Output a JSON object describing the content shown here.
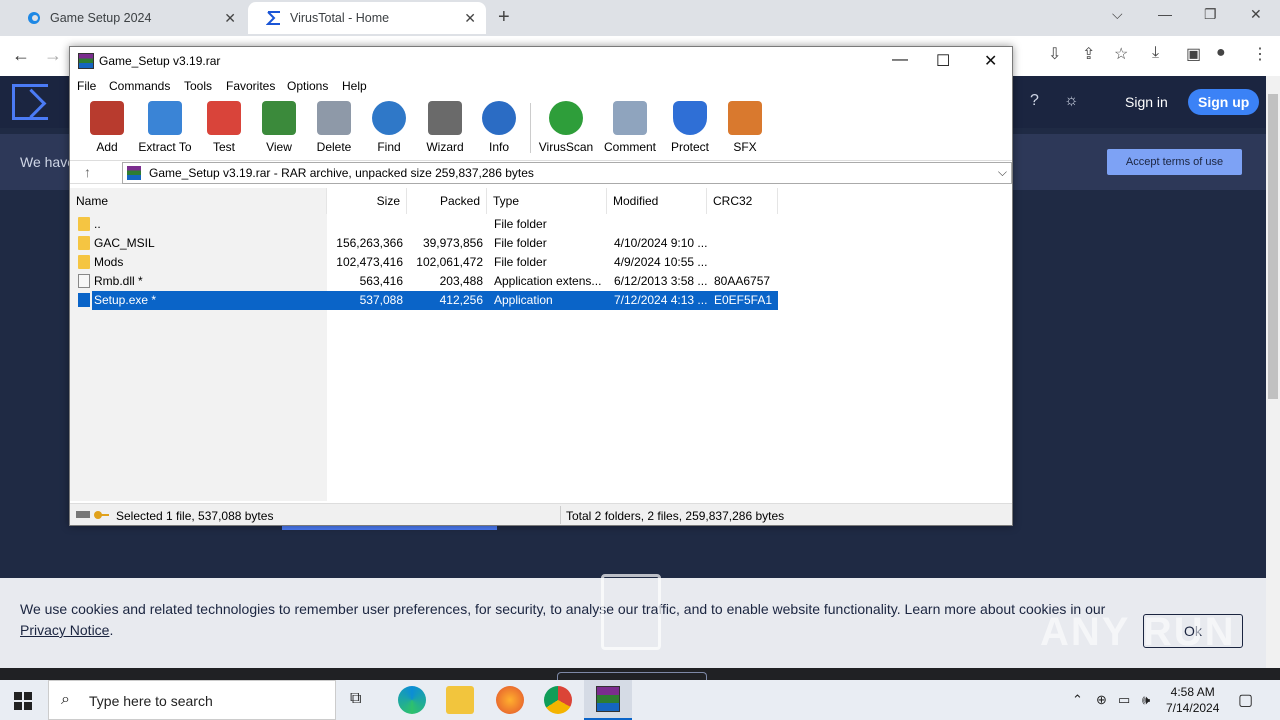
{
  "browser": {
    "tabs": [
      {
        "title": "Game Setup 2024"
      },
      {
        "title": "VirusTotal - Home"
      }
    ]
  },
  "virustotal": {
    "signin": "Sign in",
    "signup": "Sign up",
    "banner_text": "We have",
    "accept_terms": "Accept terms of use",
    "cookie_text": "We use cookies and related technologies to remember user preferences, for security, to analyse our traffic, and to enable website functionality. Learn more about cookies in our ",
    "cookie_link": "Privacy Notice",
    "cookie_ok": "Ok",
    "watermark": "ANY RUN"
  },
  "winrar": {
    "title": "Game_Setup v3.19.rar",
    "menu": [
      "File",
      "Commands",
      "Tools",
      "Favorites",
      "Options",
      "Help"
    ],
    "toolbar": [
      {
        "label": "Add",
        "icon": "add-archive-icon",
        "color": "#b83b2e"
      },
      {
        "label": "Extract To",
        "icon": "extract-folder-icon",
        "color": "#3a84d6"
      },
      {
        "label": "Test",
        "icon": "test-checklist-icon",
        "color": "#d9443a"
      },
      {
        "label": "View",
        "icon": "view-book-icon",
        "color": "#3b8a3b"
      },
      {
        "label": "Delete",
        "icon": "delete-trash-icon",
        "color": "#8e99a8"
      },
      {
        "label": "Find",
        "icon": "find-magnifier-icon",
        "color": "#2f78c8"
      },
      {
        "label": "Wizard",
        "icon": "wizard-wand-icon",
        "color": "#6a6a6a"
      },
      {
        "label": "Info",
        "icon": "info-icon",
        "color": "#2b6cc4"
      },
      {
        "label": "VirusScan",
        "icon": "virusscan-bug-icon",
        "color": "#2e9e3a"
      },
      {
        "label": "Comment",
        "icon": "comment-icon",
        "color": "#8fa4be"
      },
      {
        "label": "Protect",
        "icon": "protect-shield-icon",
        "color": "#2f6fd6"
      },
      {
        "label": "SFX",
        "icon": "sfx-box-icon",
        "color": "#d9792e"
      }
    ],
    "address": "Game_Setup v3.19.rar - RAR archive, unpacked size 259,837,286 bytes",
    "columns": [
      "Name",
      "Size",
      "Packed",
      "Type",
      "Modified",
      "CRC32"
    ],
    "rows": [
      {
        "name": "..",
        "size": "",
        "packed": "",
        "type": "File folder",
        "modified": "",
        "crc": "",
        "kind": "folder"
      },
      {
        "name": "GAC_MSIL",
        "size": "156,263,366",
        "packed": "39,973,856",
        "type": "File folder",
        "modified": "4/10/2024 9:10 ...",
        "crc": "",
        "kind": "folder"
      },
      {
        "name": "Mods",
        "size": "102,473,416",
        "packed": "102,061,472",
        "type": "File folder",
        "modified": "4/9/2024 10:55 ...",
        "crc": "",
        "kind": "folder"
      },
      {
        "name": "Rmb.dll *",
        "size": "563,416",
        "packed": "203,488",
        "type": "Application extens...",
        "modified": "6/12/2013 3:58 ...",
        "crc": "80AA6757",
        "kind": "dll"
      },
      {
        "name": "Setup.exe *",
        "size": "537,088",
        "packed": "412,256",
        "type": "Application",
        "modified": "7/12/2024 4:13 ...",
        "crc": "E0EF5FA1",
        "kind": "exe",
        "selected": true
      }
    ],
    "status_left": "Selected 1 file, 537,088 bytes",
    "status_right": "Total 2 folders, 2 files, 259,837,286 bytes"
  },
  "taskbar": {
    "search_placeholder": "Type here to search",
    "time": "4:58 AM",
    "date": "7/14/2024"
  }
}
